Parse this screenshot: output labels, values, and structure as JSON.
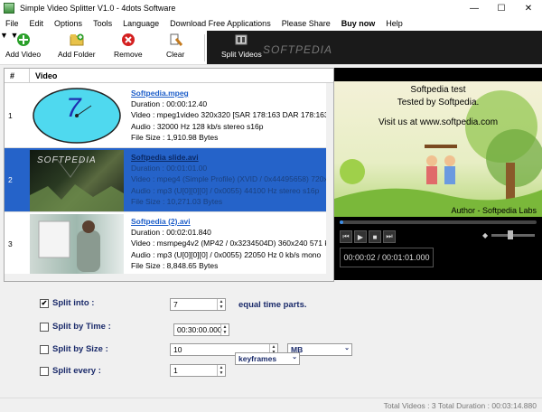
{
  "window": {
    "title": "Simple Video Splitter V1.0 - 4dots Software"
  },
  "menu": [
    "File",
    "Edit",
    "Options",
    "Tools",
    "Language",
    "Download Free Applications",
    "Please Share",
    "Buy now",
    "Help"
  ],
  "toolbar": {
    "add_video": "Add Video",
    "add_folder": "Add Folder",
    "remove": "Remove",
    "clear": "Clear",
    "split_videos": "Split Videos",
    "watermark": "SOFTPEDIA"
  },
  "list": {
    "col_num": "#",
    "col_video": "Video",
    "rows": [
      {
        "num": "1",
        "filename": "Softpedia.mpeg",
        "duration": "Duration : 00:00:12.40",
        "video": "Video : mpeg1video 320x320 [SAR 178:163 DAR 178:163]",
        "audio": "Audio : 32000 Hz 128 kb/s stereo s16p",
        "size": "File Size : 1,910.98 Bytes",
        "thumb_text": "7"
      },
      {
        "num": "2",
        "filename": "Softpedia slide.avi",
        "duration": "Duration : 00:01:01.00",
        "video": "Video : mpeg4 (Simple Profile) (XVID / 0x44495658) 720x480",
        "audio": "Audio : mp3 (U[0][0][0] / 0x0055) 44100 Hz stereo s16p",
        "size": "File Size : 10,271.03 Bytes",
        "thumb_text": "SOFTPEDIA"
      },
      {
        "num": "3",
        "filename": "Softpedia (2).avi",
        "duration": "Duration : 00:02:01.840",
        "video": "Video : msmpeg4v2 (MP42 / 0x3234504D) 360x240 571 kb/s",
        "audio": "Audio : mp3 (U[0][0][0] / 0x0055) 22050 Hz 0 kb/s mono",
        "size": "File Size : 8,848.65 Bytes",
        "thumb_text": ""
      }
    ]
  },
  "player": {
    "line1": "Softpedia test",
    "line2": "Tested by Softpedia.",
    "line3": "Visit us at www.softpedia.com",
    "line4": "Author - Softpedia Labs",
    "time": "00:00:02 / 00:01:01.000",
    "progress": 0.02
  },
  "options": {
    "split_into": {
      "label": "Split into :",
      "checked": true,
      "value": "7",
      "suffix": "equal time parts."
    },
    "split_by_time": {
      "label": "Split by Time :",
      "checked": false,
      "value": "00:30:00.000"
    },
    "split_by_size": {
      "label": "Split by Size :",
      "checked": false,
      "value": "10",
      "unit": "MB"
    },
    "split_every": {
      "label": "Split every :",
      "checked": false,
      "value": "1",
      "unit": "keyframes"
    }
  },
  "status": {
    "text": "Total Videos : 3   Total Duration : 00:03:14.880"
  }
}
